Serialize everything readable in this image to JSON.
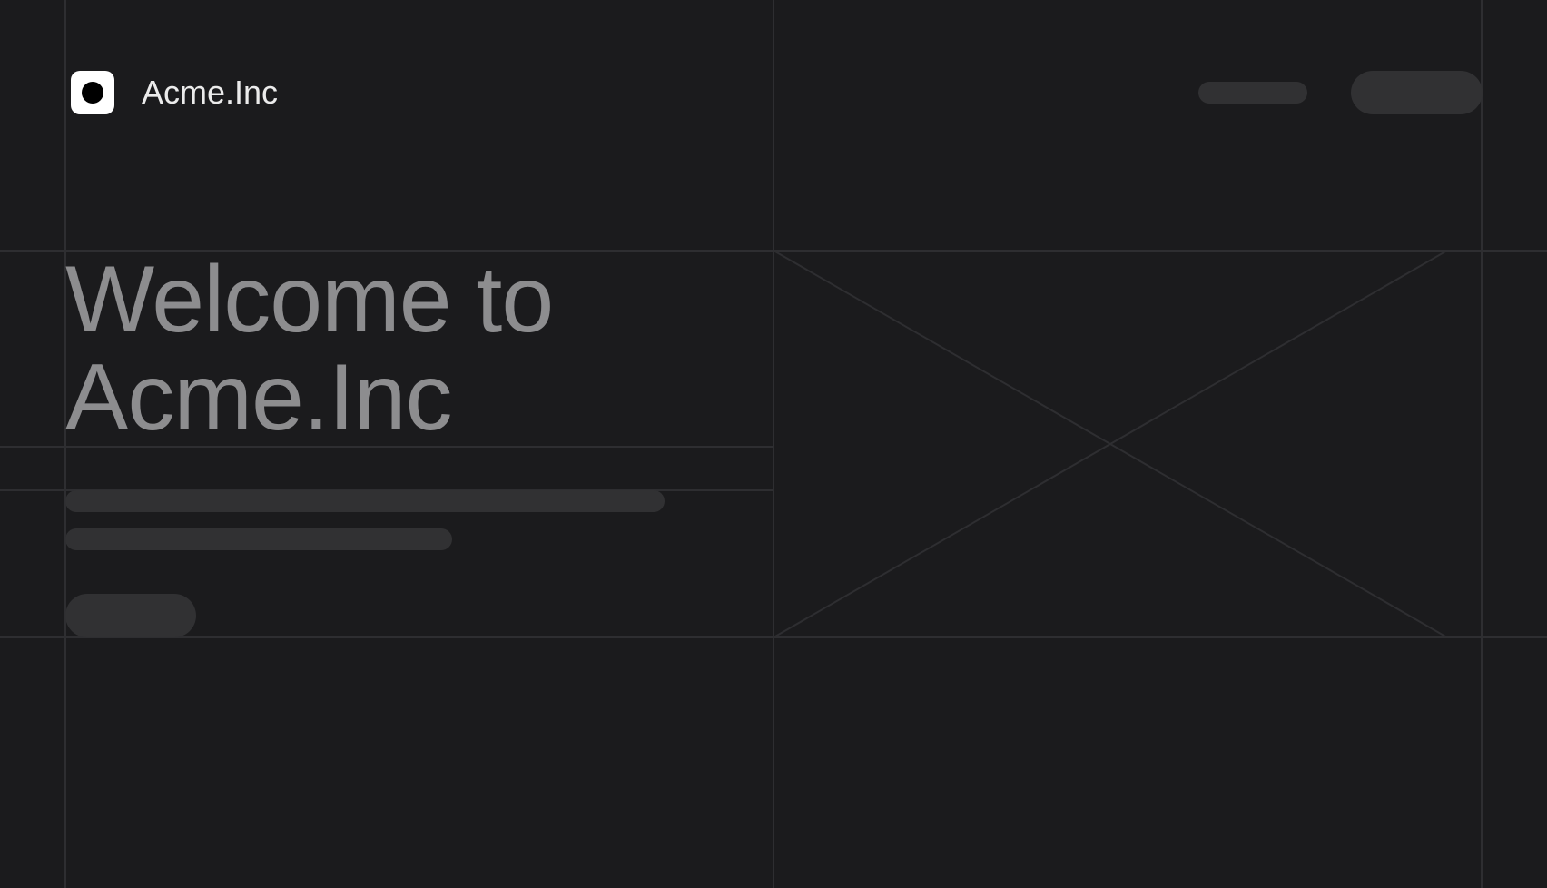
{
  "brand": {
    "name": "Acme.Inc",
    "logo_icon": "logo-dot-icon"
  },
  "hero": {
    "title_line_1": "Welcome to",
    "title_line_2": "Acme.Inc"
  },
  "placeholders": {
    "image_icon": "image-placeholder-icon"
  },
  "colors": {
    "background": "#1b1b1d",
    "gridline": "#2e2e31",
    "skeleton": "#313133",
    "title": "#8d8d8f",
    "brand_text": "#ebebeb",
    "logo_bg": "#ffffff",
    "logo_dot": "#000000"
  }
}
